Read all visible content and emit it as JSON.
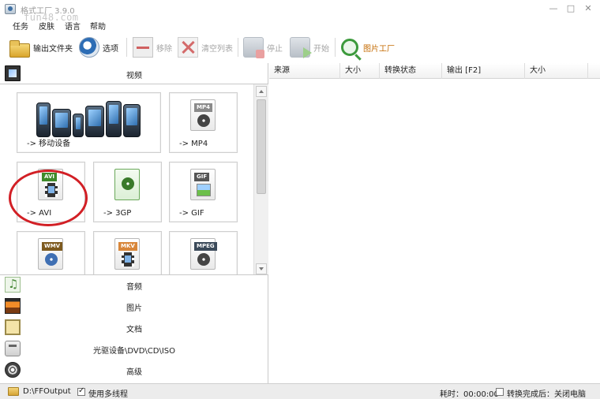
{
  "window": {
    "title": "格式工厂 3.9.0",
    "watermark": "fun48.com",
    "controls": {
      "minimize": "—",
      "maximize": "□",
      "close": "✕"
    }
  },
  "menu": [
    "任务",
    "皮肤",
    "语言",
    "帮助"
  ],
  "toolbar": {
    "output_folder": "输出文件夹",
    "options": "选项",
    "remove": "移除",
    "clear_list": "清空列表",
    "stop": "停止",
    "start": "开始",
    "picture_factory": "图片工厂"
  },
  "categories": {
    "video": "视频",
    "audio": "音频",
    "image": "图片",
    "document": "文档",
    "disc": "光驱设备\\DVD\\CD\\ISO",
    "advanced": "高级"
  },
  "video_tiles": [
    {
      "label": "-> 移动设备"
    },
    {
      "label": "-> MP4",
      "tag": "MP4",
      "tag_color": "#8a8a8a"
    },
    {
      "label": "-> AVI",
      "tag": "AVI",
      "tag_color": "#3f8a2a"
    },
    {
      "label": "-> 3GP"
    },
    {
      "label": "-> GIF",
      "tag": "GIF",
      "tag_color": "#555555"
    },
    {
      "label": "",
      "tag": "WMV",
      "tag_color": "#7d5a1f"
    },
    {
      "label": "",
      "tag": "MKV",
      "tag_color": "#d8863a"
    },
    {
      "label": "",
      "tag": "MPEG",
      "tag_color": "#3b4a5a"
    }
  ],
  "task_columns": [
    "来源",
    "大小",
    "转换状态",
    "输出 [F2]",
    "大小"
  ],
  "status": {
    "output_path": "D:\\FFOutput",
    "multithread_label": "使用多线程",
    "multithread_checked": true,
    "elapsed": "耗时：00:00:00",
    "shutdown_label": "转换完成后：关闭电脑",
    "shutdown_checked": false
  },
  "colors": {
    "highlight_circle": "#d21f25",
    "accent_green": "#3c9a3c"
  }
}
